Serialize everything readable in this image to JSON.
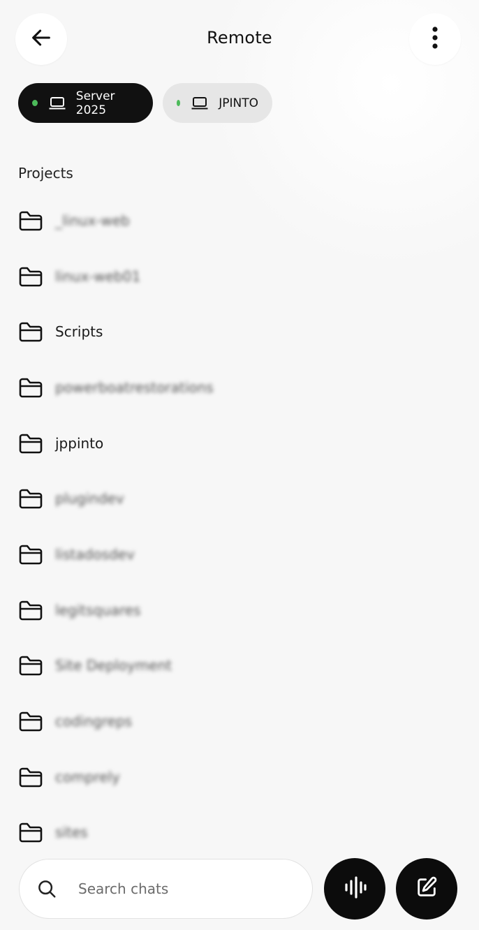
{
  "header": {
    "title": "Remote"
  },
  "icons": {
    "back": "arrow-left-icon",
    "more": "more-vertical-icon",
    "laptop": "laptop-icon",
    "folder": "folder-icon",
    "search": "search-icon",
    "voice": "audio-wave-icon",
    "compose": "edit-icon"
  },
  "colors": {
    "online_dot": "#4cba5a",
    "active_chip_bg": "#111111",
    "inactive_chip_bg": "#e6e6e6",
    "fab_bg": "#0c0c0c"
  },
  "devices": [
    {
      "label": "Server 2025",
      "selected": true,
      "online": true
    },
    {
      "label": "JPINTO",
      "selected": false,
      "online": true
    }
  ],
  "projects_section": {
    "label": "Projects",
    "items": [
      {
        "name": "_linux-web",
        "blurred": true
      },
      {
        "name": "linux-web01",
        "blurred": true
      },
      {
        "name": "Scripts",
        "blurred": false
      },
      {
        "name": "powerboatrestorations",
        "blurred": true
      },
      {
        "name": "jppinto",
        "blurred": false
      },
      {
        "name": "plugindev",
        "blurred": true
      },
      {
        "name": "listadosdev",
        "blurred": true
      },
      {
        "name": "legitsquares",
        "blurred": true
      },
      {
        "name": "Site Deployment",
        "blurred": true
      },
      {
        "name": "codingreps",
        "blurred": true
      },
      {
        "name": "comprely",
        "blurred": true
      },
      {
        "name": "sites",
        "blurred": true
      }
    ]
  },
  "search": {
    "placeholder": "Search chats",
    "value": ""
  }
}
